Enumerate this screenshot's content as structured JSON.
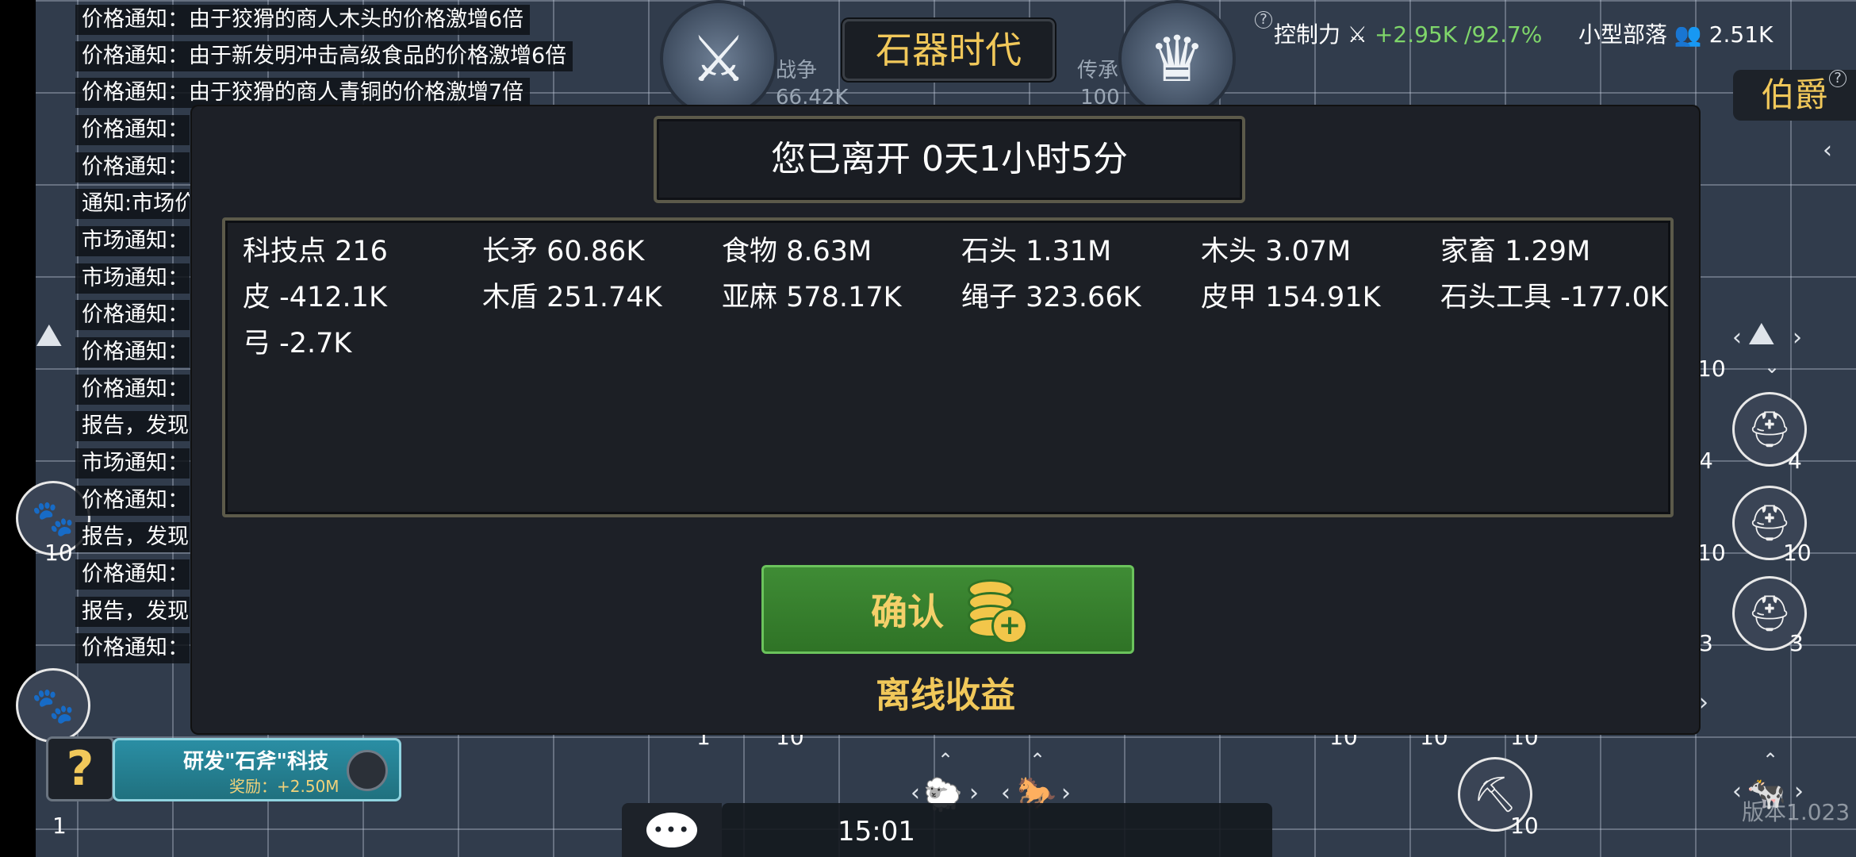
{
  "header": {
    "era_title": "石器时代",
    "war_label": "战争",
    "war_value": "66.42K",
    "heritage_label": "传承",
    "heritage_value": "100",
    "control_label": "控制力",
    "control_value": "+2.95K",
    "control_percent": "/92.7%",
    "tribe_label": "小型部落",
    "tribe_value": "2.51K",
    "rank_title": "伯爵",
    "war_icon": "crossed-swords-icon",
    "heritage_icon": "crown-icon"
  },
  "notifications": [
    "价格通知：由于狡猾的商人木头的价格激增6倍",
    "价格通知：由于新发明冲击高级食品的价格激增6倍",
    "价格通知：由于狡猾的商人青铜的价格激增7倍",
    "价格通知：",
    "价格通知：",
    "通知:市场价",
    "市场通知：",
    "市场通知：",
    "价格通知：",
    "价格通知：",
    "价格通知：",
    "报告，发现",
    "市场通知：",
    "价格通知：",
    "报告，发现",
    "价格通知：",
    "报告，发现",
    "价格通知："
  ],
  "modal": {
    "title": "您已离开 0天1小时5分",
    "resources": [
      "科技点 216",
      "长矛 60.86K",
      "食物 8.63M",
      "石头 1.31M",
      "木头 3.07M",
      "家畜 1.29M",
      "皮 -412.1K",
      "木盾 251.74K",
      "亚麻 578.17K",
      "绳子 323.66K",
      "皮甲 154.91K",
      "石头工具 -177.0K",
      "弓 -2.7K"
    ],
    "confirm_label": "确认",
    "confirm_icon": "coins-plus-icon",
    "footer_label": "离线收益"
  },
  "research": {
    "help_label": "?",
    "title": "研发\"石斧\"科技",
    "reward": "奖励：+2.50M"
  },
  "bottom_bar": {
    "chat_icon": "chat-bubble-icon",
    "time": "15:01"
  },
  "board_numbers": [
    "10",
    "4",
    "10",
    "10",
    "3",
    "3",
    "4",
    "10",
    "10",
    "10",
    "10",
    "10",
    "1",
    "10",
    "1",
    "10"
  ],
  "version": "版本1.023",
  "colors": {
    "accent_gold": "#f1c85a",
    "confirm_green": "#3f8c35",
    "positive_green": "#7fd66a",
    "research_teal": "#2a8ea4"
  }
}
